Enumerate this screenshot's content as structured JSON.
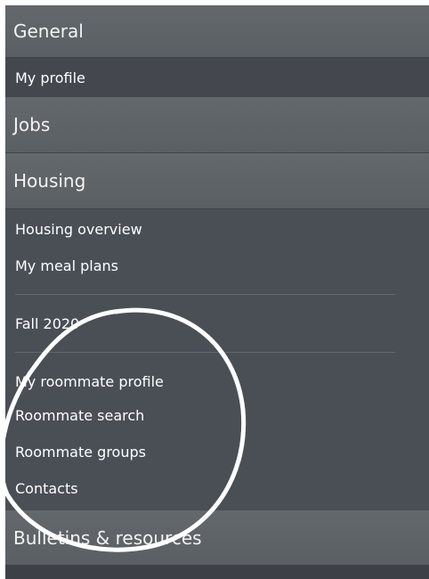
{
  "nav": {
    "general": {
      "label": "General",
      "items": [
        "My profile"
      ]
    },
    "jobs": {
      "label": "Jobs"
    },
    "housing": {
      "label": "Housing",
      "items": [
        "Housing overview",
        "My meal plans"
      ],
      "term": "Fall 2020",
      "term_items": [
        "My roommate profile",
        "Roommate search",
        "Roommate groups",
        "Contacts"
      ]
    },
    "bulletins": {
      "label": "Bulletins & resources"
    }
  },
  "annotation": {
    "shape": "hand-drawn circle",
    "color": "#ffffff"
  }
}
